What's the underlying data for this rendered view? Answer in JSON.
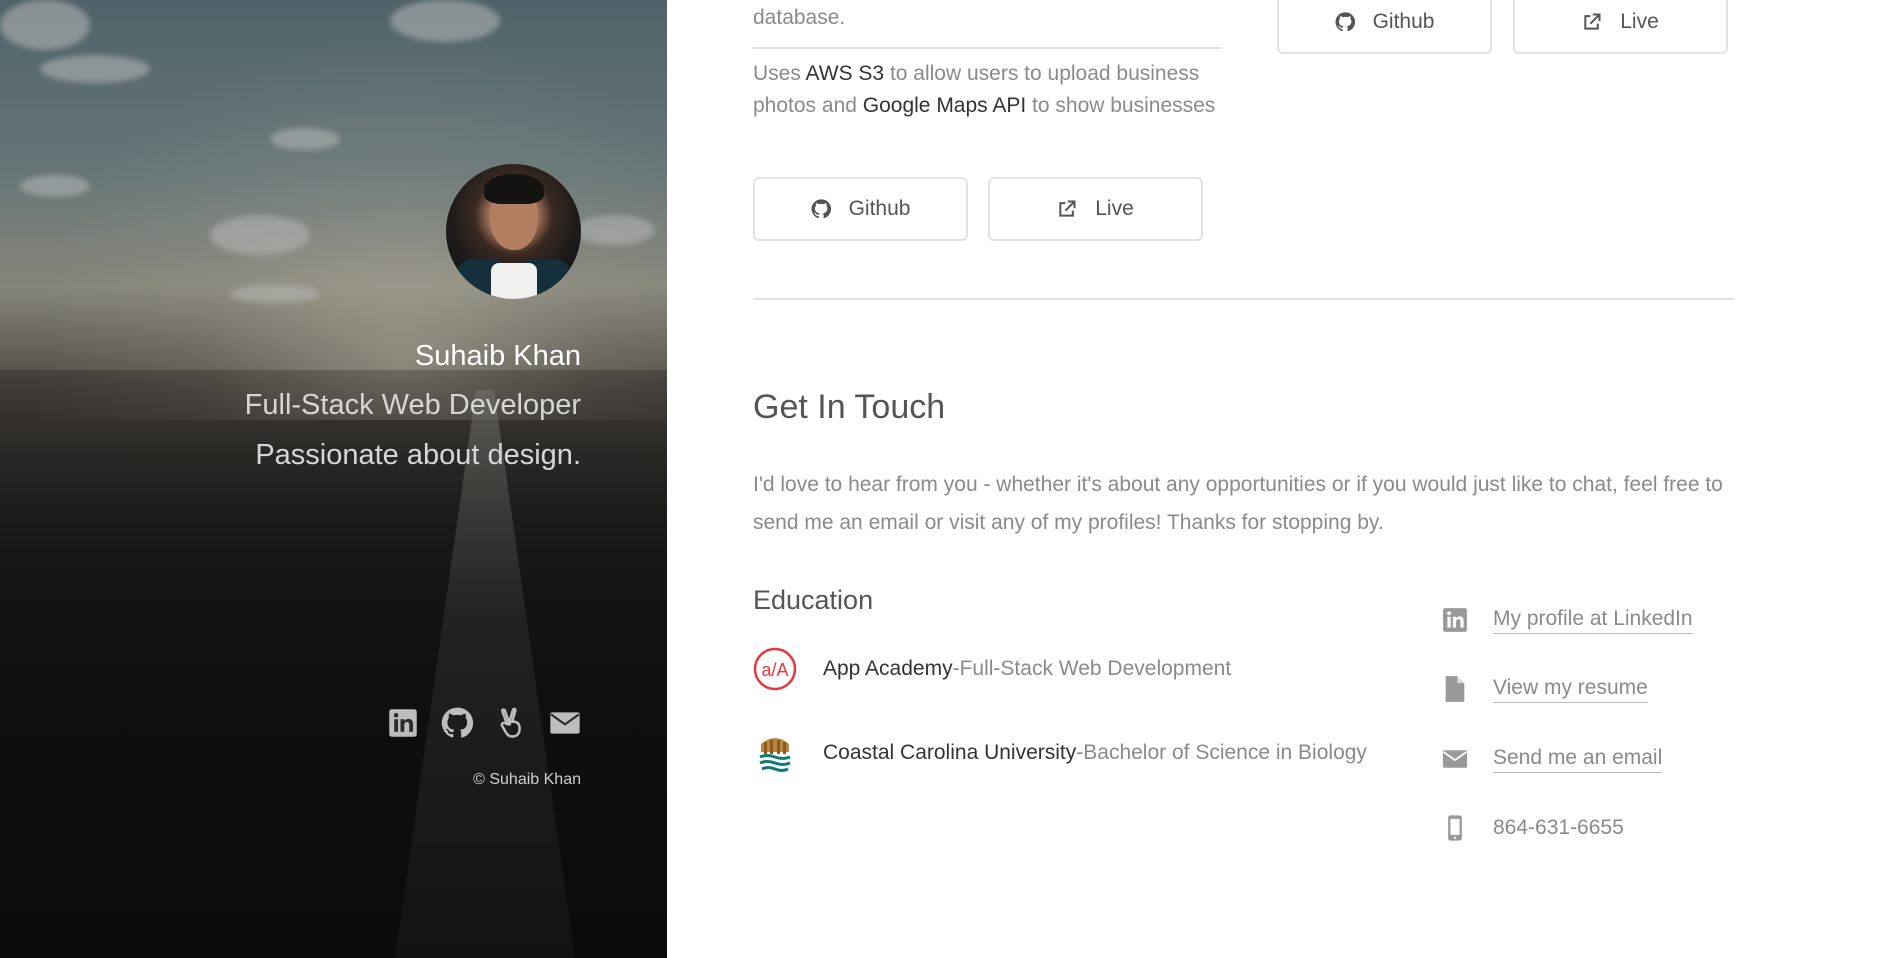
{
  "profile": {
    "name": "Suhaib Khan",
    "role": "Full-Stack Web Developer",
    "tagline": "Passionate about design.",
    "copyright": "© Suhaib Khan",
    "social_icons": [
      "linkedin-icon",
      "github-icon",
      "angellist-icon",
      "envelope-icon"
    ]
  },
  "project_top": {
    "desc_tail": "database.",
    "buttons": {
      "github_label": "Github",
      "live_label": "Live"
    }
  },
  "project_current": {
    "desc_before1": "Uses ",
    "tech1": "AWS S3",
    "desc_mid1": " to allow users to upload business",
    "desc_before2": "photos and ",
    "tech2": "Google Maps API",
    "desc_after2": " to show businesses",
    "buttons": {
      "github_label": "Github",
      "live_label": "Live"
    }
  },
  "contact_section": {
    "title": "Get In Touch",
    "text": "I'd love to hear from you - whether it's about any opportunities or if you would just like to chat, feel free to send me an email or visit any of my profiles! Thanks for stopping by."
  },
  "education": {
    "title": "Education",
    "items": [
      {
        "school": "App Academy",
        "separator": " - ",
        "degree": "Full-Stack Web Development",
        "logo": "app-academy-logo"
      },
      {
        "school": "Coastal Carolina University",
        "separator": " - ",
        "degree": "Bachelor of Science in Biology",
        "logo": "coastal-carolina-logo"
      }
    ]
  },
  "contact_links": [
    {
      "icon": "linkedin-icon",
      "label": "My profile at LinkedIn"
    },
    {
      "icon": "file-icon",
      "label": "View my resume"
    },
    {
      "icon": "envelope-icon",
      "label": "Send me an email"
    },
    {
      "icon": "mobile-phone-icon",
      "label": "864-631-6655"
    }
  ],
  "colors": {
    "accent_red": "#e8373f",
    "text_dark": "#333333",
    "text_muted": "#8a8a8a"
  }
}
